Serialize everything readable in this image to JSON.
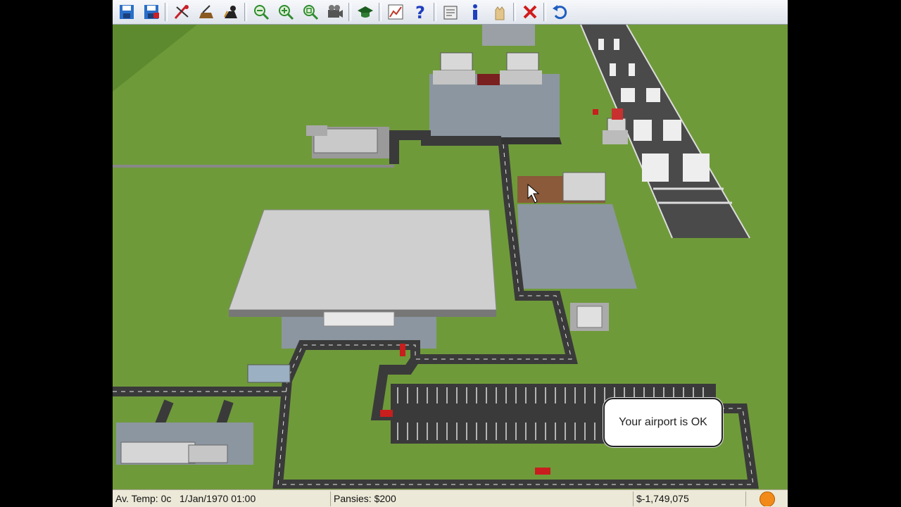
{
  "toolbar": {
    "buttons": [
      {
        "icon": "save-icon",
        "color": "#2a6fc9"
      },
      {
        "icon": "save-as-icon",
        "color": "#2a6fc9"
      },
      {
        "icon": "demolish-icon",
        "color": "#c8202a"
      },
      {
        "icon": "build-icon",
        "color": "#8a5a20"
      },
      {
        "icon": "bulldozer-icon",
        "color": "#333333"
      },
      {
        "icon": "zoom-out-icon",
        "color": "#2e8b2e"
      },
      {
        "icon": "zoom-in-icon",
        "color": "#2e8b2e"
      },
      {
        "icon": "zoom-fit-icon",
        "color": "#2e8b2e"
      },
      {
        "icon": "camera-icon",
        "color": "#555555"
      },
      {
        "icon": "graduation-cap-icon",
        "color": "#1b5e20"
      },
      {
        "icon": "graph-icon",
        "color": "#c0392b"
      },
      {
        "icon": "help-icon",
        "color": "#1f3fbf"
      },
      {
        "icon": "report-icon",
        "color": "#444444"
      },
      {
        "icon": "info-icon",
        "color": "#1f3fbf"
      },
      {
        "icon": "hand-icon",
        "color": "#e3c48a"
      },
      {
        "icon": "close-icon",
        "color": "#d01c1c"
      },
      {
        "icon": "undo-icon",
        "color": "#1f5fbf"
      }
    ]
  },
  "status": {
    "temp": "Av. Temp: 0c",
    "date": "1/Jan/1970 01:00",
    "pansies": "Pansies: $200",
    "money": "$-1,749,075",
    "mood_icon": "smiley-icon"
  },
  "notification": {
    "text": "Your airport is OK"
  },
  "colors": {
    "grass": "#6f9a3a",
    "road": "#3a3a3a",
    "apron": "#8c96a0",
    "runway": "#4a4a4a"
  }
}
